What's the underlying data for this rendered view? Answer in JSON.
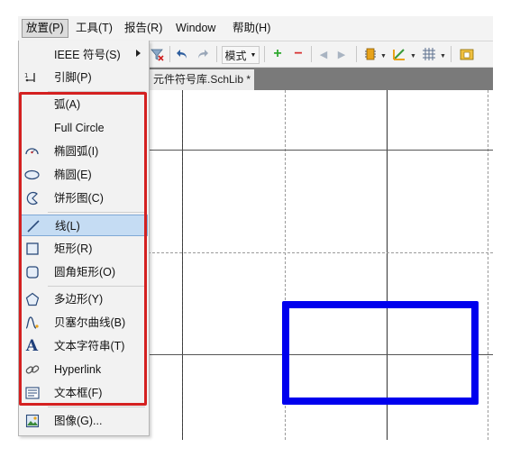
{
  "menubar": {
    "items": [
      "放置(P)",
      "工具(T)",
      "报告(R)",
      "Window",
      "帮助(H)"
    ]
  },
  "toolbar": {
    "mode_label": "模式"
  },
  "doc_tab": {
    "title": "元件符号库.SchLib *"
  },
  "dropdown": {
    "items": [
      {
        "label": "IEEE 符号(S)",
        "icon": "none",
        "submenu": true
      },
      {
        "label": "引脚(P)",
        "icon": "pin-icon"
      },
      {
        "label": "弧(A)",
        "icon": "none"
      },
      {
        "label": "Full Circle",
        "icon": "none"
      },
      {
        "label": "椭圆弧(I)",
        "icon": "elliptical-arc-icon"
      },
      {
        "label": "椭圆(E)",
        "icon": "ellipse-icon"
      },
      {
        "label": "饼形图(C)",
        "icon": "pie-icon"
      },
      {
        "label": "线(L)",
        "icon": "line-icon",
        "highlighted": true
      },
      {
        "label": "矩形(R)",
        "icon": "rectangle-icon"
      },
      {
        "label": "圆角矩形(O)",
        "icon": "round-rectangle-icon"
      },
      {
        "label": "多边形(Y)",
        "icon": "polygon-icon"
      },
      {
        "label": "贝塞尔曲线(B)",
        "icon": "bezier-icon"
      },
      {
        "label": "文本字符串(T)",
        "icon": "text-string-icon"
      },
      {
        "label": "Hyperlink",
        "icon": "hyperlink-icon"
      },
      {
        "label": "文本框(F)",
        "icon": "text-frame-icon"
      },
      {
        "label": "图像(G)...",
        "icon": "image-icon"
      }
    ]
  },
  "colors": {
    "highlight_box": "#d42020",
    "canvas_rect": "#0000ee",
    "menu_highlight": "#c5dcf3"
  }
}
